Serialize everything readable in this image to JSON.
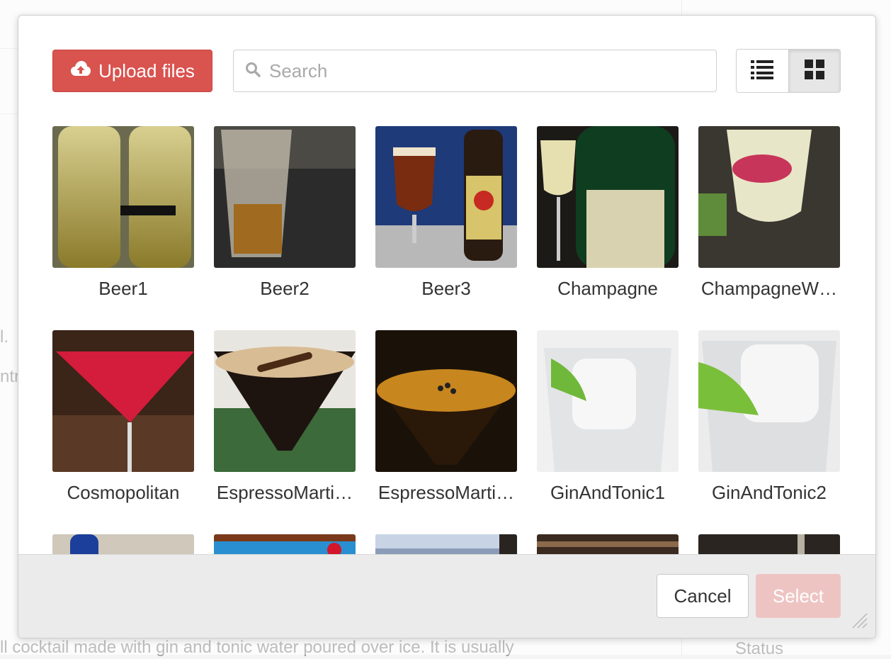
{
  "background": {
    "text_bottom": "ll cocktail made with gin and tonic water poured over ice. It is usually",
    "text_left_1": "l.",
    "text_left_2": "ntry",
    "text_right_status": "Status"
  },
  "toolbar": {
    "upload_label": "Upload files",
    "search_placeholder": "Search",
    "view_list_icon": "list-icon",
    "view_grid_icon": "grid-icon",
    "active_view": "grid"
  },
  "files": [
    {
      "name": "Beer1"
    },
    {
      "name": "Beer2"
    },
    {
      "name": "Beer3"
    },
    {
      "name": "Champagne"
    },
    {
      "name": "ChampagneW…"
    },
    {
      "name": "Cosmopolitan"
    },
    {
      "name": "EspressoMarti…"
    },
    {
      "name": "EspressoMarti…"
    },
    {
      "name": "GinAndTonic1"
    },
    {
      "name": "GinAndTonic2"
    }
  ],
  "footer": {
    "cancel_label": "Cancel",
    "select_label": "Select"
  },
  "colors": {
    "upload_button": "#d9534f",
    "select_disabled": "#eec4c3"
  }
}
